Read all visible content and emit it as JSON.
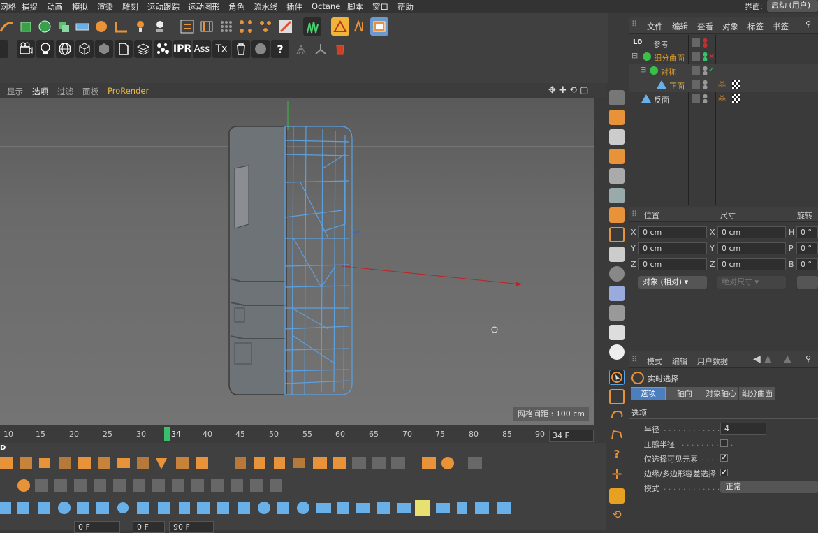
{
  "menubar": {
    "items": [
      "网格",
      "捕捉",
      "动画",
      "模拟",
      "渲染",
      "雕刻",
      "运动跟踪",
      "运动图形",
      "角色",
      "流水线",
      "插件",
      "Octane",
      "脚本",
      "窗口",
      "帮助"
    ],
    "layout_label": "界面:",
    "layout_value": "启动 (用户)"
  },
  "toolbar": {
    "text_buttons": [
      "IPR",
      "Ass",
      "Tx",
      "?"
    ]
  },
  "viewport": {
    "menu": [
      "显示",
      "选项",
      "过滤",
      "面板",
      "ProRender"
    ],
    "grid_info": "网格间距 : 100 cm"
  },
  "timeline": {
    "ticks": [
      "10",
      "15",
      "20",
      "25",
      "30",
      "34",
      "40",
      "45",
      "50",
      "55",
      "60",
      "65",
      "70",
      "75",
      "80",
      "85",
      "90"
    ],
    "current_frame": "34",
    "frame_field": "34 F"
  },
  "bottom": {
    "field1": "0 F",
    "field2": "0 F",
    "field3": "90 F"
  },
  "object_manager": {
    "tabs": [
      "文件",
      "编辑",
      "查看",
      "对象",
      "标签",
      "书签"
    ],
    "objects": [
      {
        "name": "参考",
        "color": "#e0e0e0"
      },
      {
        "name": "细分曲面",
        "color": "#d89a2a"
      },
      {
        "name": "对称",
        "color": "#d89a2a"
      },
      {
        "name": "正面",
        "color": "#e8b84a"
      },
      {
        "name": "反面",
        "color": "#e0e0e0"
      }
    ]
  },
  "coordinates": {
    "headers": [
      "位置",
      "尺寸",
      "旋转"
    ],
    "rows": [
      {
        "axis": "X",
        "pos": "0 cm",
        "size_axis": "X",
        "size": "0 cm",
        "rot_axis": "H",
        "rot": "0 °"
      },
      {
        "axis": "Y",
        "pos": "0 cm",
        "size_axis": "Y",
        "size": "0 cm",
        "rot_axis": "P",
        "rot": "0 °"
      },
      {
        "axis": "Z",
        "pos": "0 cm",
        "size_axis": "Z",
        "size": "0 cm",
        "rot_axis": "B",
        "rot": "0 °"
      }
    ],
    "mode_select": "对象 (相对)",
    "size_select": "绝对尺寸"
  },
  "attributes": {
    "tabs": [
      "模式",
      "编辑",
      "用户数据"
    ],
    "tool_name": "实时选择",
    "subtabs": [
      "选项",
      "轴向",
      "对象轴心",
      "细分曲面"
    ],
    "section": "选项",
    "props": [
      {
        "label": "半径",
        "value": "4"
      },
      {
        "label": "压感半径",
        "value": ""
      },
      {
        "label": "仅选择可见元素",
        "value": "✔"
      },
      {
        "label": "边缘/多边形容差选择",
        "value": "✔"
      },
      {
        "label": "模式",
        "value": "正常"
      }
    ]
  },
  "colors": {
    "accent_blue": "#5ba0e0",
    "selected_tab": "#4d7fbf",
    "orange": "#e8923a"
  }
}
